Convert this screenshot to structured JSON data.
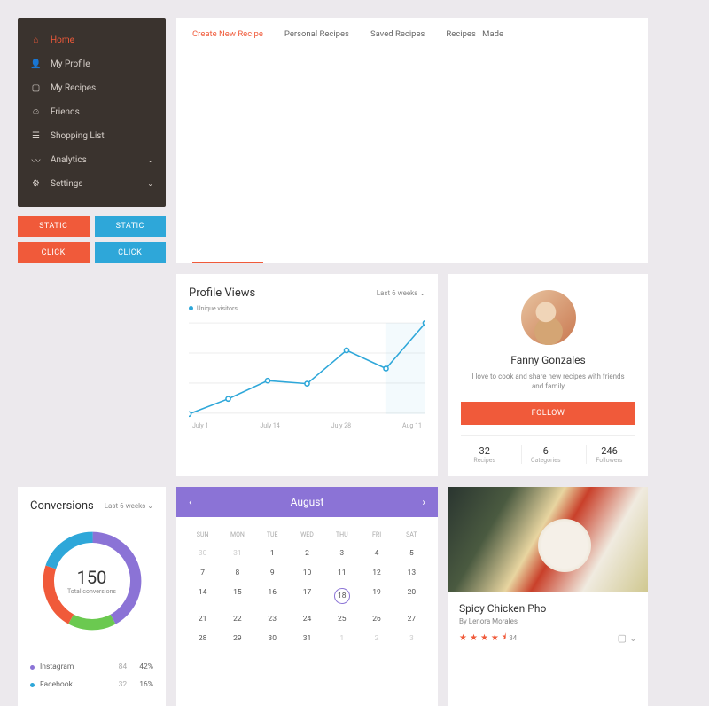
{
  "sidebar": {
    "items": [
      {
        "label": "Home",
        "icon": "home",
        "active": true
      },
      {
        "label": "My Profile",
        "icon": "user"
      },
      {
        "label": "My Recipes",
        "icon": "doc"
      },
      {
        "label": "Friends",
        "icon": "smile"
      },
      {
        "label": "Shopping List",
        "icon": "list"
      },
      {
        "label": "Analytics",
        "icon": "chart",
        "chevron": true
      },
      {
        "label": "Settings",
        "icon": "gear",
        "chevron": true
      }
    ]
  },
  "buttons": {
    "static": "STATIC",
    "click": "CLICK"
  },
  "tabs": [
    {
      "label": "Create New Recipe",
      "active": true
    },
    {
      "label": "Personal Recipes"
    },
    {
      "label": "Saved Recipes"
    },
    {
      "label": "Recipes I Made"
    }
  ],
  "chart": {
    "title": "Profile Views",
    "period": "Last 6 weeks",
    "legend": "Unique visitors"
  },
  "chart_data": {
    "type": "line",
    "x": [
      "July 1",
      "July 14",
      "July 28",
      "Aug 11"
    ],
    "values": [
      20,
      30,
      42,
      40,
      62,
      50,
      80
    ],
    "ylim": [
      20,
      80
    ],
    "title": "Profile Views",
    "ylabel": "",
    "xlabel": ""
  },
  "profile": {
    "name": "Fanny Gonzales",
    "bio": "I love to cook and share new recipes with friends and family",
    "follow": "FOLLOW",
    "stats": [
      {
        "n": "32",
        "l": "Recipes"
      },
      {
        "n": "6",
        "l": "Categories"
      },
      {
        "n": "246",
        "l": "Followers"
      }
    ]
  },
  "conversions": {
    "title": "Conversions",
    "period": "Last 6 weeks",
    "total": "150",
    "total_label": "Total conversions",
    "rows": [
      {
        "name": "Instagram",
        "count": "84",
        "pct": "42%",
        "color": "#8b73d6"
      },
      {
        "name": "Facebook",
        "count": "32",
        "pct": "16%",
        "color": "#2ea7d9"
      }
    ]
  },
  "calendar": {
    "month": "August",
    "dow": [
      "SUN",
      "MON",
      "TUE",
      "WED",
      "THU",
      "FRI",
      "SAT"
    ],
    "weeks": [
      [
        {
          "d": "30",
          "m": true
        },
        {
          "d": "31",
          "m": true
        },
        {
          "d": "1"
        },
        {
          "d": "2"
        },
        {
          "d": "3"
        },
        {
          "d": "4"
        },
        {
          "d": "5"
        }
      ],
      [
        {
          "d": "7"
        },
        {
          "d": "8"
        },
        {
          "d": "9"
        },
        {
          "d": "10"
        },
        {
          "d": "11"
        },
        {
          "d": "12"
        },
        {
          "d": "13"
        }
      ],
      [
        {
          "d": "14"
        },
        {
          "d": "15"
        },
        {
          "d": "16"
        },
        {
          "d": "17"
        },
        {
          "d": "18",
          "sel": true
        },
        {
          "d": "19"
        },
        {
          "d": "20"
        }
      ],
      [
        {
          "d": "21"
        },
        {
          "d": "22"
        },
        {
          "d": "23"
        },
        {
          "d": "24"
        },
        {
          "d": "25"
        },
        {
          "d": "26"
        },
        {
          "d": "27"
        }
      ],
      [
        {
          "d": "28"
        },
        {
          "d": "29"
        },
        {
          "d": "30"
        },
        {
          "d": "31"
        },
        {
          "d": "1",
          "m": true
        },
        {
          "d": "2",
          "m": true
        },
        {
          "d": "3",
          "m": true
        }
      ]
    ]
  },
  "recipe": {
    "title": "Spicy Chicken Pho",
    "author": "By Lenora Morales",
    "rating": "34"
  },
  "colors": {
    "accent": "#f05a3a",
    "blue": "#2ea7d9",
    "purple": "#8b73d6",
    "green": "#6bc950"
  }
}
